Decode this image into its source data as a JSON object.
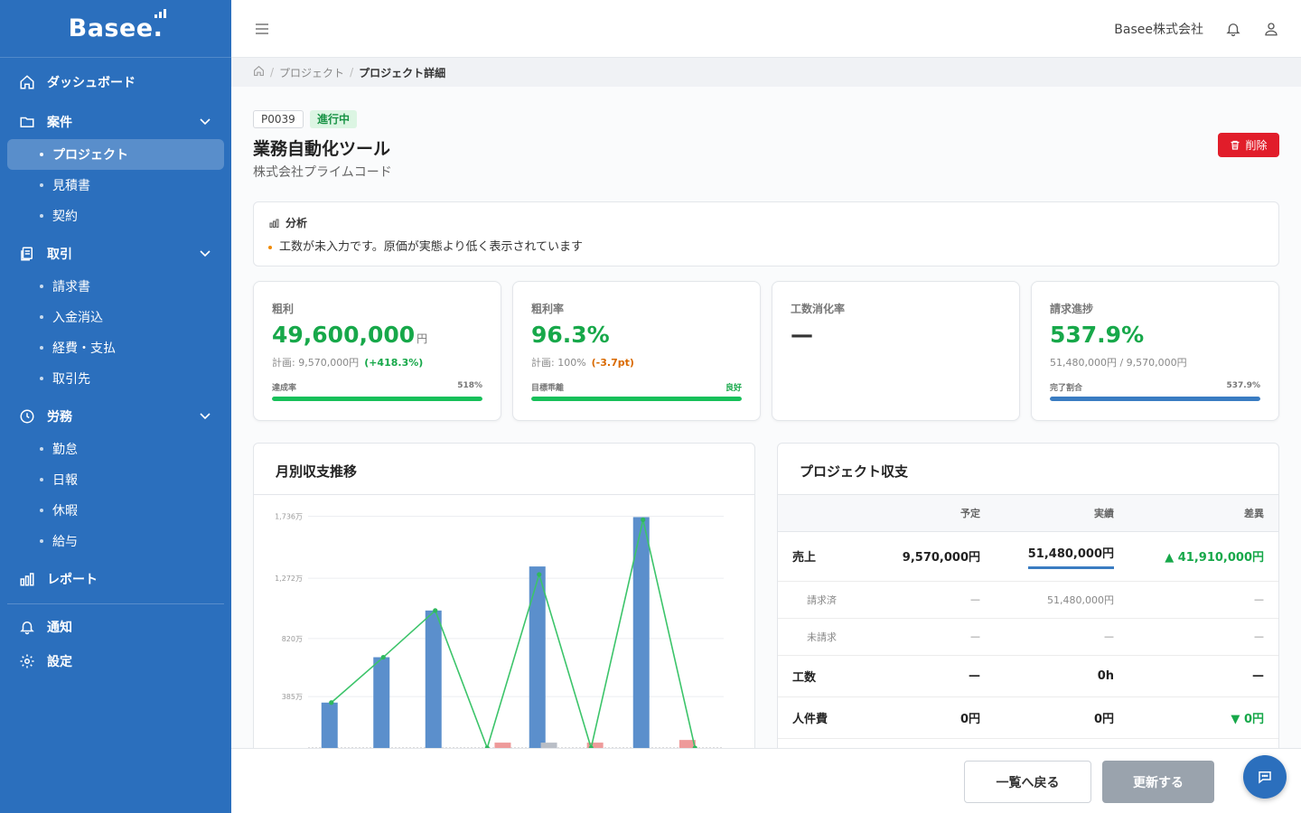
{
  "app": {
    "logo": "Basee"
  },
  "sidebar": {
    "dashboard": "ダッシュボード",
    "cases": {
      "label": "案件",
      "items": [
        "プロジェクト",
        "見積書",
        "契約"
      ]
    },
    "transactions": {
      "label": "取引",
      "items": [
        "請求書",
        "入金消込",
        "経費・支払",
        "取引先"
      ]
    },
    "labor": {
      "label": "労務",
      "items": [
        "勤怠",
        "日報",
        "休暇",
        "給与"
      ]
    },
    "report": "レポート",
    "notifications": "通知",
    "settings": "設定"
  },
  "topbar": {
    "company": "Basee株式会社"
  },
  "breadcrumb": {
    "items": [
      "プロジェクト",
      "プロジェクト詳細"
    ]
  },
  "project": {
    "id": "P0039",
    "status": "進行中",
    "title": "業務自動化ツール",
    "client": "株式会社プライムコード",
    "delete_label": "削除"
  },
  "analysis": {
    "title": "分析",
    "message": "工数が未入力です。原価が実態より低く表示されています"
  },
  "kpis": [
    {
      "label": "粗利",
      "value": "49,600,000",
      "unit": "円",
      "sub": "計画: 9,570,000円",
      "delta": "(+418.3%)",
      "bar_label": "達成率",
      "bar_value": "518%",
      "fill": 1.0
    },
    {
      "label": "粗利率",
      "value": "96.3%",
      "sub": "計画: 100%",
      "delta": "(-3.7pt)",
      "bar_label": "目標乖離",
      "bar_value": "良好",
      "fill": 1.0
    },
    {
      "label": "工数消化率",
      "value": "—"
    },
    {
      "label": "請求進捗",
      "value": "537.9%",
      "sub": "51,480,000円 / 9,570,000円",
      "bar_label": "完了割合",
      "bar_value": "537.9%",
      "fill": 1.0
    }
  ],
  "colors": {
    "accent": "#2b6fbd",
    "positive": "#17a84a",
    "danger": "#e11d2a"
  },
  "monthly_chart": {
    "title": "月別収支推移",
    "chart_data": {
      "type": "bar",
      "y_tick_labels": [
        "385万",
        "820万",
        "1,272万",
        "1,736万"
      ],
      "y_ticks": [
        3850000,
        8200000,
        12720000,
        17360000
      ],
      "ylim": [
        0,
        17600000
      ],
      "series": [
        {
          "values": [
            3400000,
            6800000,
            10300000,
            13600000,
            17300000
          ]
        },
        {
          "values": [
            0,
            0,
            0,
            0,
            400000,
            0,
            400000,
            0,
            600000
          ]
        },
        {
          "values": [
            0,
            0,
            0,
            0,
            0,
            400000,
            0,
            0,
            0
          ]
        },
        {
          "values": [
            3400000,
            6800000,
            10300000,
            0,
            13000000,
            0,
            17100000,
            0
          ]
        }
      ],
      "grid": true
    }
  },
  "pl_table": {
    "title": "プロジェクト収支",
    "columns": [
      "予定",
      "実績",
      "差異"
    ],
    "rows": [
      {
        "label": "売上",
        "plan": "9,570,000円",
        "actual": "51,480,000円",
        "diff": "▲ 41,910,000円"
      },
      {
        "label": "請求済",
        "plan": "—",
        "actual": "51,480,000円",
        "diff": "—"
      },
      {
        "label": "未請求",
        "plan": "—",
        "actual": "—",
        "diff": "—"
      },
      {
        "label": "工数",
        "plan": "—",
        "actual": "0h",
        "diff": "—"
      },
      {
        "label": "人件費",
        "plan": "0円",
        "actual": "0円",
        "diff": "▼ 0円"
      }
    ]
  },
  "footer": {
    "back_label": "一覧へ戻る",
    "update_label": "更新する"
  }
}
